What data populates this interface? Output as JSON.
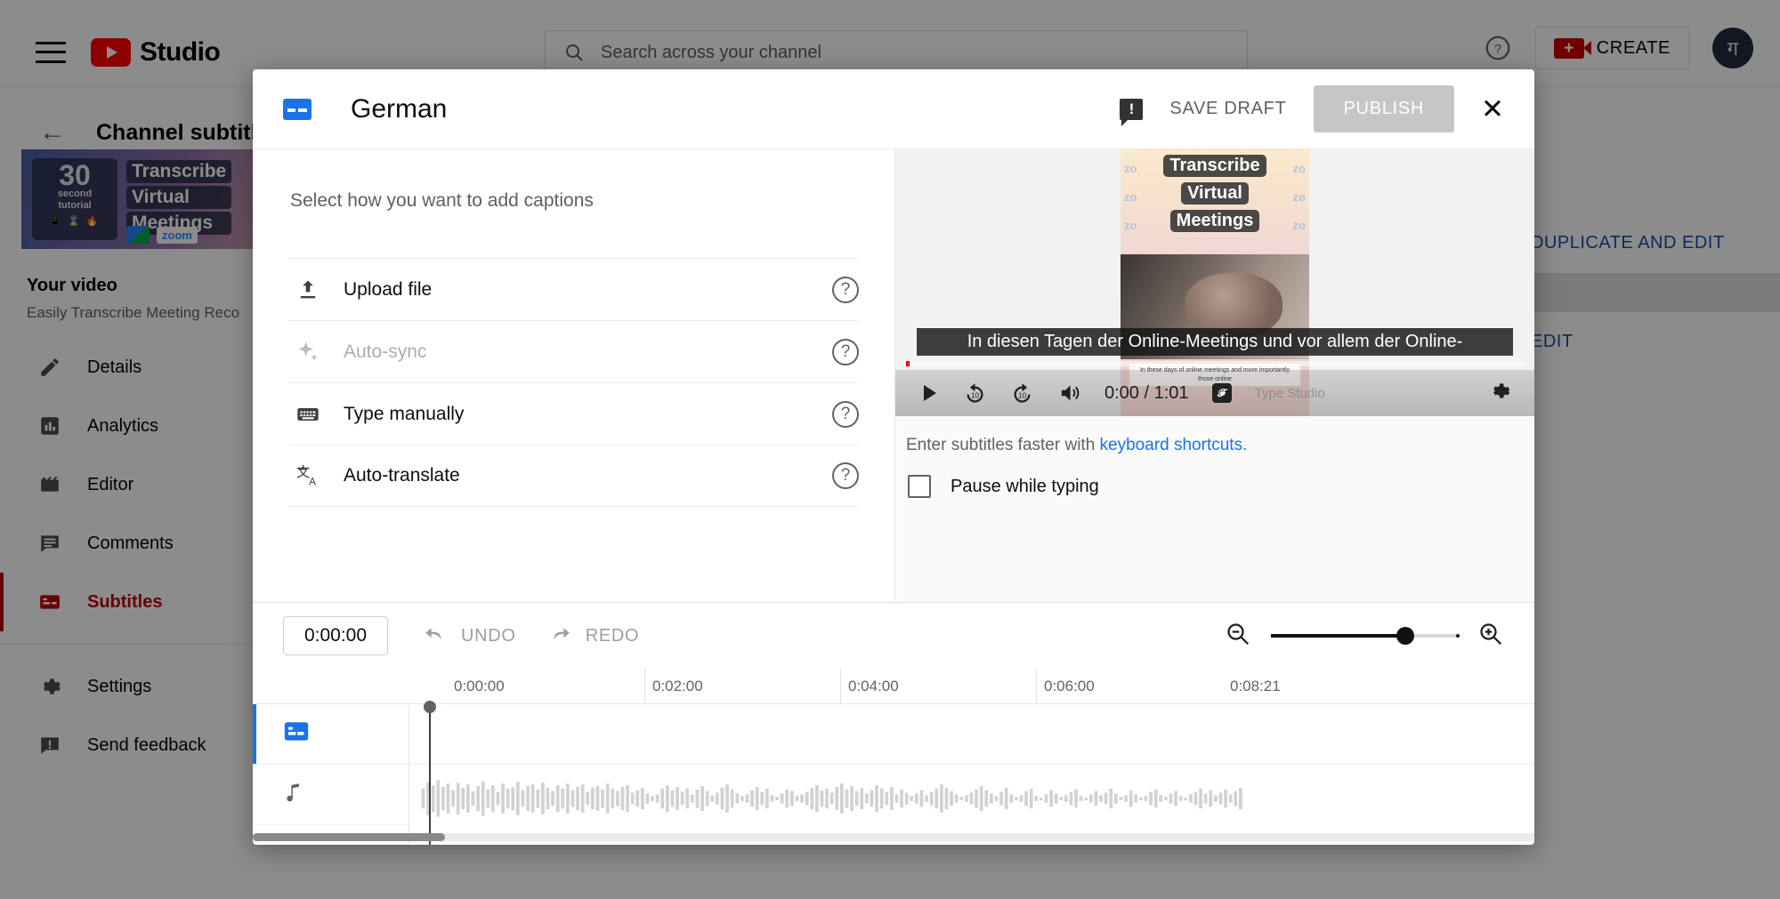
{
  "topbar": {
    "menu_icon": "hamburger-icon",
    "logo_text": "Studio",
    "search_placeholder": "Search across your channel",
    "help_icon": "help-icon",
    "create_label": "CREATE",
    "avatar_initial": "ग"
  },
  "background": {
    "page_title": "Channel subtitles",
    "thumbnail": {
      "badge_number": "30",
      "badge_line1": "second",
      "badge_line2": "tutorial",
      "badge_emoji": "📱 ⌛ 🔥",
      "title_lines": [
        "Transcribe",
        "Virtual",
        "Meetings"
      ],
      "logo_zoom": "zoom"
    },
    "your_video_label": "Your video",
    "video_subtitle": "Easily Transcribe Meeting Reco",
    "nav_items": [
      {
        "label": "Details",
        "icon": "pencil-icon",
        "active": false
      },
      {
        "label": "Analytics",
        "icon": "bar-chart-icon",
        "active": false
      },
      {
        "label": "Editor",
        "icon": "clapperboard-icon",
        "active": false
      },
      {
        "label": "Comments",
        "icon": "comment-icon",
        "active": false
      },
      {
        "label": "Subtitles",
        "icon": "captions-icon",
        "active": true
      },
      {
        "label": "Settings",
        "icon": "gear-icon",
        "active": false
      },
      {
        "label": "Send feedback",
        "icon": "feedback-icon",
        "active": false
      }
    ],
    "right_actions": [
      "DUPLICATE AND EDIT",
      "EDIT"
    ]
  },
  "dialog": {
    "title": "German",
    "title_icon": "captions-icon",
    "feedback_icon": "feedback-icon",
    "save_draft_label": "SAVE DRAFT",
    "publish_label": "PUBLISH",
    "close_icon": "close-icon",
    "section_heading": "Select how you want to add captions",
    "options": [
      {
        "label": "Upload file",
        "icon": "upload-icon",
        "disabled": false,
        "help": "?"
      },
      {
        "label": "Auto-sync",
        "icon": "sparkle-icon",
        "disabled": true,
        "help": "?"
      },
      {
        "label": "Type manually",
        "icon": "keyboard-icon",
        "disabled": false,
        "help": "?"
      },
      {
        "label": "Auto-translate",
        "icon": "translate-icon",
        "disabled": false,
        "help": "?"
      }
    ],
    "player": {
      "video_caption_lines": [
        "Transcribe",
        "Virtual",
        "Meetings"
      ],
      "burned_caption": "In these days of online meetings and more importantly those online",
      "subtitle_overlay": "In diesen Tagen der Online-Meetings und vor allem der Online-",
      "current_time": "0:00",
      "duration": "1:01",
      "time_display": "0:00 / 1:01",
      "watermark": "Type Studio",
      "controls": [
        "play-icon",
        "rewind-10-icon",
        "forward-10-icon",
        "volume-icon",
        "settings-gear-icon"
      ]
    },
    "shortcut_prefix": "Enter subtitles faster with ",
    "shortcut_link": "keyboard shortcuts",
    "shortcut_suffix": ".",
    "pause_while_typing_label": "Pause while typing",
    "pause_while_typing_checked": false
  },
  "timeline": {
    "timestamp_value": "0:00:00",
    "undo_label": "UNDO",
    "redo_label": "REDO",
    "zoom_out_icon": "zoom-out-icon",
    "zoom_in_icon": "zoom-in-icon",
    "zoom_level_percent": 72,
    "ruler_ticks": [
      "0:00:00",
      "0:02:00",
      "0:04:00",
      "0:06:00",
      "0:08:21"
    ],
    "tracks": [
      {
        "name": "subtitles-track",
        "icon": "captions-icon",
        "active": true
      },
      {
        "name": "audio-track",
        "icon": "music-note-icon",
        "active": false
      }
    ],
    "playhead_time": "0:00:00"
  },
  "colors": {
    "accent_blue": "#1a73e8",
    "youtube_red": "#ff0000",
    "active_red": "#c00000",
    "link_blue": "#174ea6",
    "disabled_gray": "#c6c6c6"
  }
}
